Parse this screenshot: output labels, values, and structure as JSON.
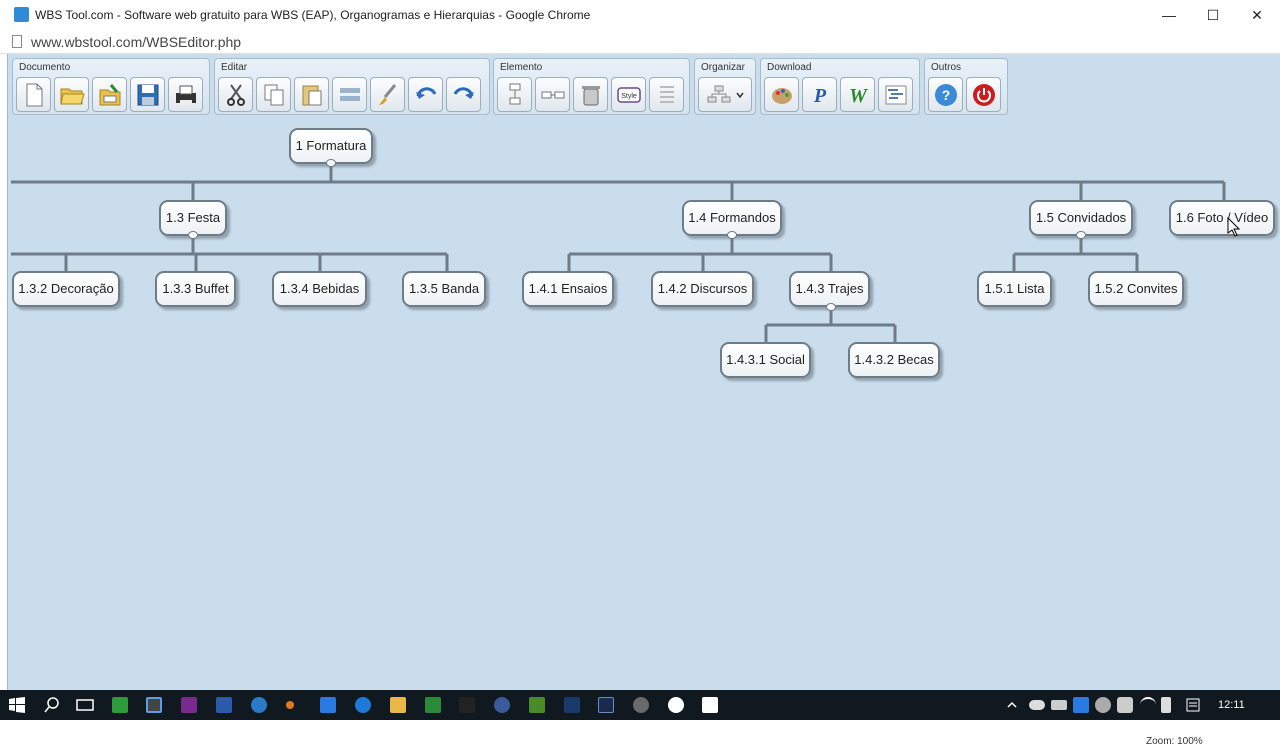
{
  "window": {
    "title": "WBS Tool.com - Software web gratuito para WBS (EAP), Organogramas e Hierarquias - Google Chrome",
    "minimize_glyph": "—",
    "maximize_glyph": "☐",
    "close_glyph": "✕"
  },
  "address_bar": {
    "url": "www.wbstool.com/WBSEditor.php"
  },
  "toolbar": {
    "groups": [
      {
        "label": "Documento",
        "buttons": [
          "new-document-icon",
          "open-folder-icon",
          "xml-import-icon",
          "save-icon",
          "print-icon"
        ]
      },
      {
        "label": "Editar",
        "buttons": [
          "cut-icon",
          "copy-icon",
          "paste-icon",
          "align-icon",
          "format-brush-icon",
          "undo-icon",
          "redo-icon"
        ]
      },
      {
        "label": "Elemento",
        "buttons": [
          "add-vertical-node-icon",
          "add-horizontal-node-icon",
          "delete-trash-icon",
          "style-icon",
          "list-icon"
        ]
      },
      {
        "label": "Organizar",
        "buttons": [
          "arrange-layout-icon"
        ]
      },
      {
        "label": "Download",
        "buttons": [
          "paint-image-icon",
          "powerpoint-icon",
          "word-icon",
          "project-icon"
        ]
      },
      {
        "label": "Outros",
        "buttons": [
          "help-icon",
          "power-exit-icon"
        ]
      }
    ],
    "style_button_text": "Style"
  },
  "wbs": {
    "nodes": [
      {
        "id": "n1",
        "label": "1 Formatura"
      },
      {
        "id": "n13",
        "label": "1.3 Festa"
      },
      {
        "id": "n14",
        "label": "1.4 Formandos"
      },
      {
        "id": "n15",
        "label": "1.5 Convidados"
      },
      {
        "id": "n16",
        "label": "1.6 Foto / Vídeo"
      },
      {
        "id": "n132",
        "label": "1.3.2 Decoração"
      },
      {
        "id": "n133",
        "label": "1.3.3 Buffet"
      },
      {
        "id": "n134",
        "label": "1.3.4 Bebidas"
      },
      {
        "id": "n135",
        "label": "1.3.5 Banda"
      },
      {
        "id": "n141",
        "label": "1.4.1 Ensaios"
      },
      {
        "id": "n142",
        "label": "1.4.2 Discursos"
      },
      {
        "id": "n143",
        "label": "1.4.3 Trajes"
      },
      {
        "id": "n151",
        "label": "1.5.1 Lista"
      },
      {
        "id": "n152",
        "label": "1.5.2 Convites"
      },
      {
        "id": "n1431",
        "label": "1.4.3.1 Social"
      },
      {
        "id": "n1432",
        "label": "1.4.3.2 Becas"
      }
    ],
    "zoom_label": "Zoom: 100%"
  },
  "taskbar": {
    "clock": "12:11",
    "colors": {
      "background": "#101820",
      "canvas": "#c9ddec",
      "node_border": "#6e7c88"
    }
  }
}
